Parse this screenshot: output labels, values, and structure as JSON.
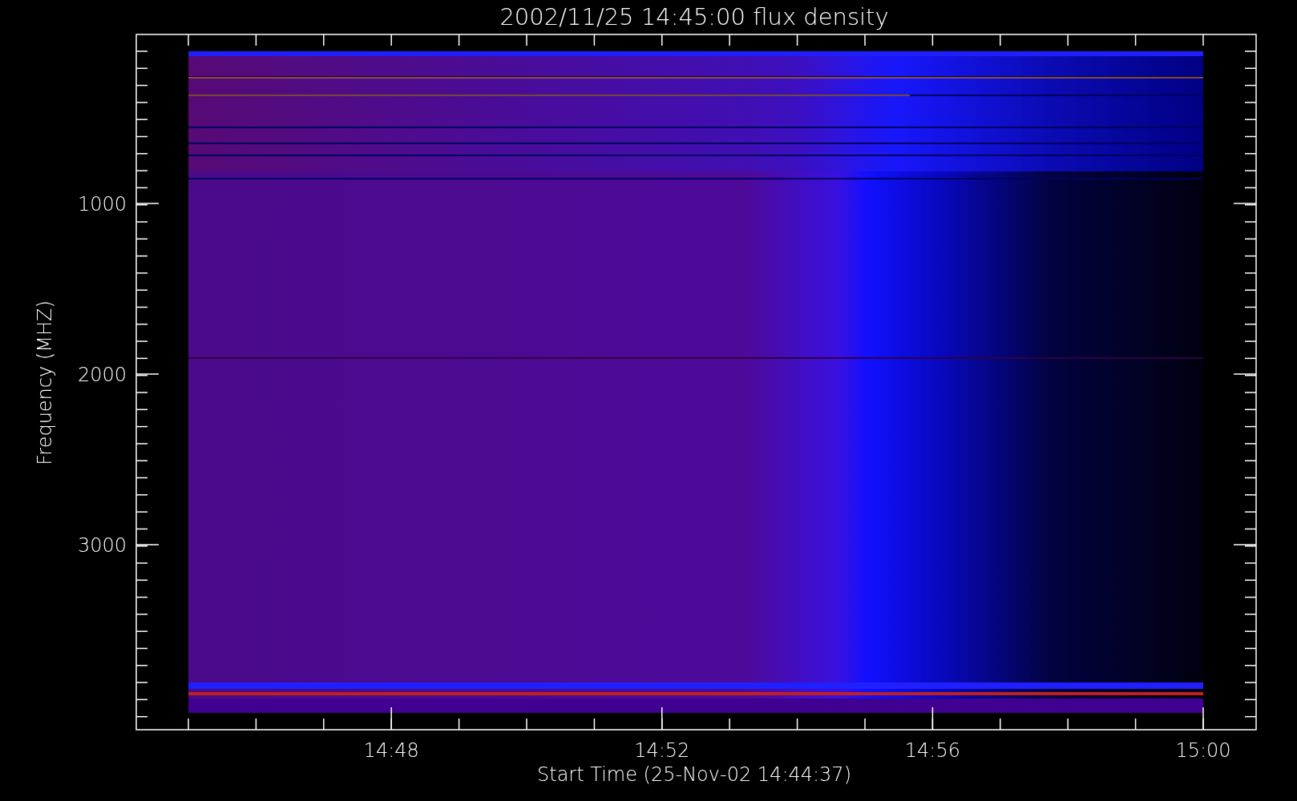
{
  "plot": {
    "title": "2002/11/25 14:45:00 flux density",
    "xlabel": "Start Time (25-Nov-02 14:44:37)",
    "ylabel": "Frequency (MHZ)",
    "xtick_labels": [
      "14:48",
      "14:52",
      "14:56",
      "15:00"
    ],
    "ytick_labels": [
      "1000",
      "2000",
      "3000"
    ]
  }
}
